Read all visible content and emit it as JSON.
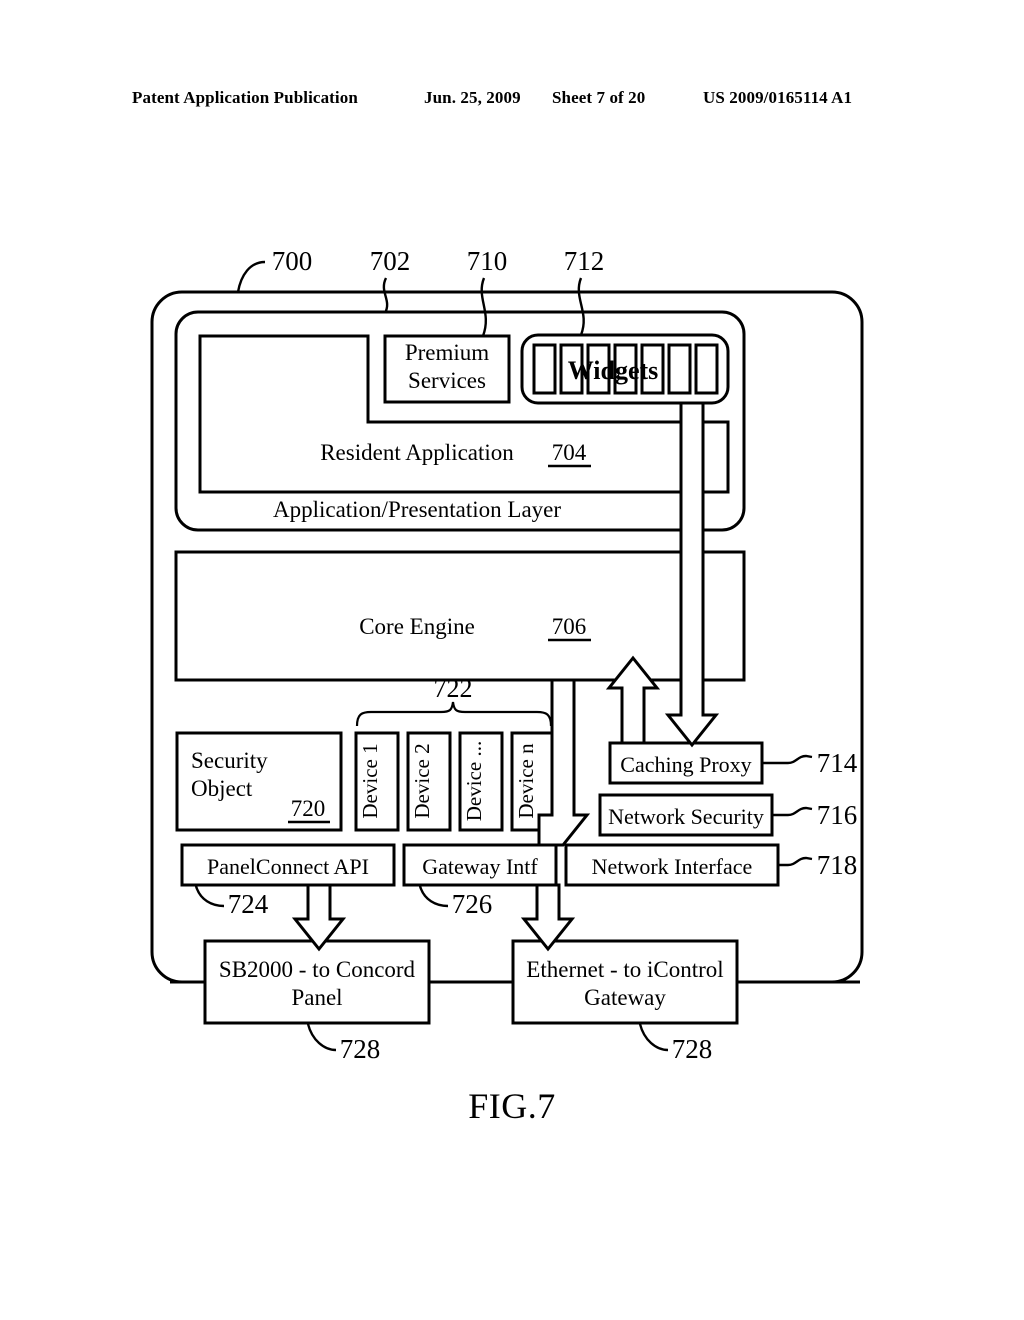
{
  "header": {
    "publication": "Patent Application Publication",
    "date": "Jun. 25, 2009",
    "sheet": "Sheet 7 of 20",
    "patent_number": "US 2009/0165114 A1"
  },
  "figure": {
    "caption": "FIG.7",
    "refs": {
      "r700": "700",
      "r702": "702",
      "r710": "710",
      "r712": "712",
      "r704": "704",
      "r706": "706",
      "r714": "714",
      "r716": "716",
      "r718": "718",
      "r720": "720",
      "r722": "722",
      "r724": "724",
      "r726": "726",
      "r728a": "728",
      "r728b": "728"
    },
    "blocks": {
      "premium_services_line1": "Premium",
      "premium_services_line2": "Services",
      "widgets": "Widgets",
      "resident_application": "Resident Application",
      "application_presentation_layer": "Application/Presentation Layer",
      "core_engine": "Core Engine",
      "security_object_line1": "Security",
      "security_object_line2": "Object",
      "device_1": "Device 1",
      "device_2": "Device 2",
      "device_ellipsis": "Device ...",
      "device_n": "Device n",
      "panelconnect_api": "PanelConnect API",
      "gateway_intf": "Gateway Intf",
      "caching_proxy": "Caching Proxy",
      "network_security": "Network Security",
      "network_interface": "Network Interface",
      "sb2000_line1": "SB2000 - to Concord",
      "sb2000_line2": "Panel",
      "ethernet_line1": "Ethernet - to iControl",
      "ethernet_line2": "Gateway"
    },
    "widget_cell_count": 7,
    "colors": {
      "ink": "#000000",
      "paper": "#ffffff"
    }
  }
}
